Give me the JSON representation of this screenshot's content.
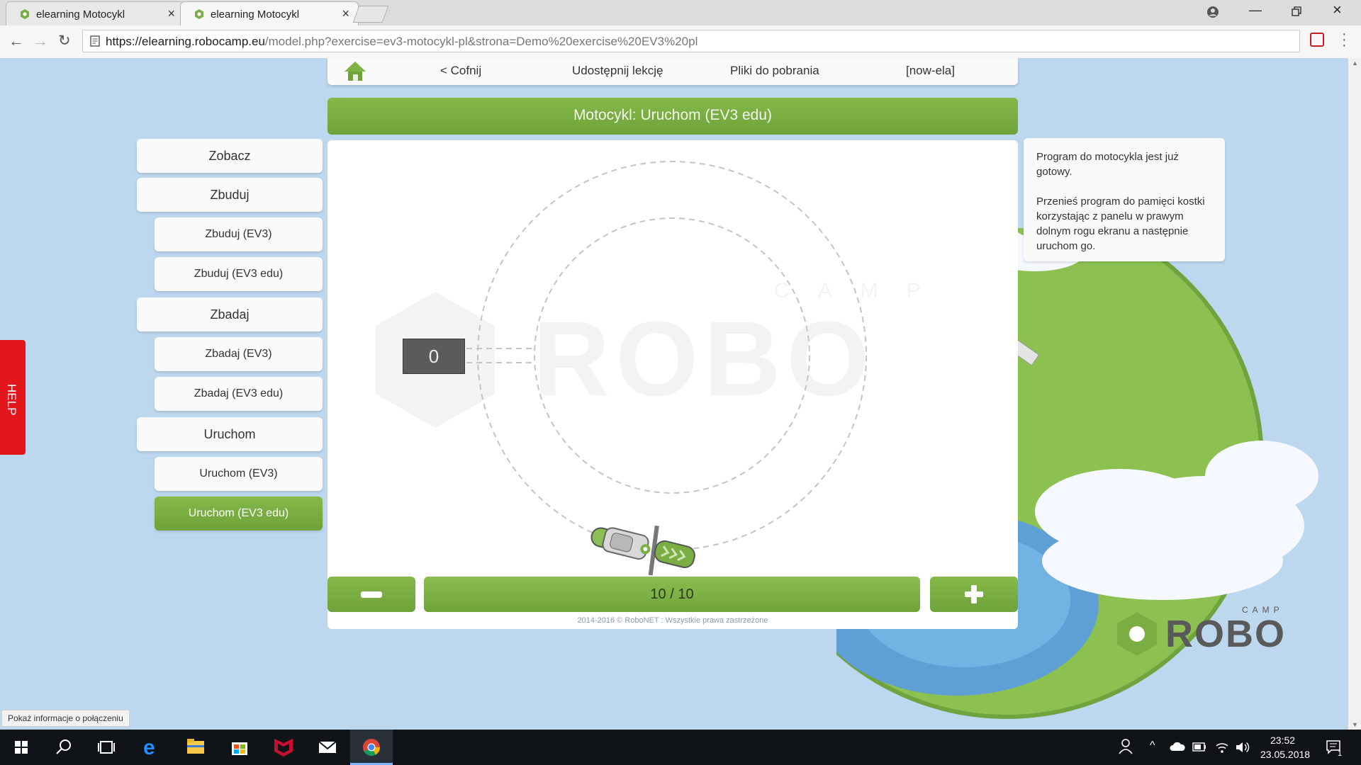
{
  "browser": {
    "tabs": [
      {
        "title": "elearning Motocykl",
        "active": false
      },
      {
        "title": "elearning Motocykl",
        "active": true
      }
    ],
    "url_host": "https://elearning.robocamp.eu",
    "url_path": "/model.php?exercise=ev3-motocykl-pl&strona=Demo%20exercise%20EV3%20pl"
  },
  "topnav": {
    "back": "< Cofnij",
    "share": "Udostępnij lekcję",
    "downloads": "Pliki do pobrania",
    "user": "[now-ela]"
  },
  "title": "Motocykl: Uruchom (EV3 edu)",
  "sidebar": {
    "items": [
      {
        "label": "Zobacz",
        "level": 1,
        "active": false
      },
      {
        "label": "Zbuduj",
        "level": 1,
        "active": false
      },
      {
        "label": "Zbuduj (EV3)",
        "level": 2,
        "active": false
      },
      {
        "label": "Zbuduj (EV3 edu)",
        "level": 2,
        "active": false
      },
      {
        "label": "Zbadaj",
        "level": 1,
        "active": false
      },
      {
        "label": "Zbadaj (EV3)",
        "level": 2,
        "active": false
      },
      {
        "label": "Zbadaj (EV3 edu)",
        "level": 2,
        "active": false
      },
      {
        "label": "Uruchom",
        "level": 1,
        "active": false
      },
      {
        "label": "Uruchom (EV3)",
        "level": 2,
        "active": false
      },
      {
        "label": "Uruchom (EV3 edu)",
        "level": 2,
        "active": true
      }
    ]
  },
  "stage": {
    "display_value": "0",
    "watermark_word": "ROBO",
    "watermark_small": "CAMP"
  },
  "info": {
    "paragraph1": "Program do motocykla jest już gotowy.",
    "paragraph2": "Przenieś program do pamięci kostki korzystając z panelu w prawym dolnym rogu ekranu a następnie uruchom go."
  },
  "pager": {
    "counter": "10 / 10"
  },
  "copyright": "2014-2016 © RoboNET : Wszystkie prawa zastrzeżone",
  "help_label": "HELP",
  "logo": {
    "word": "ROBO",
    "small": "CAMP"
  },
  "status_bubble": "Pokaż informacje o połączeniu",
  "taskbar": {
    "time": "23:52",
    "date": "23.05.2018",
    "notifications": "1"
  },
  "colors": {
    "accent_green": "#7aae43",
    "page_bg": "#bcd7ee",
    "help_red": "#e3161b"
  }
}
